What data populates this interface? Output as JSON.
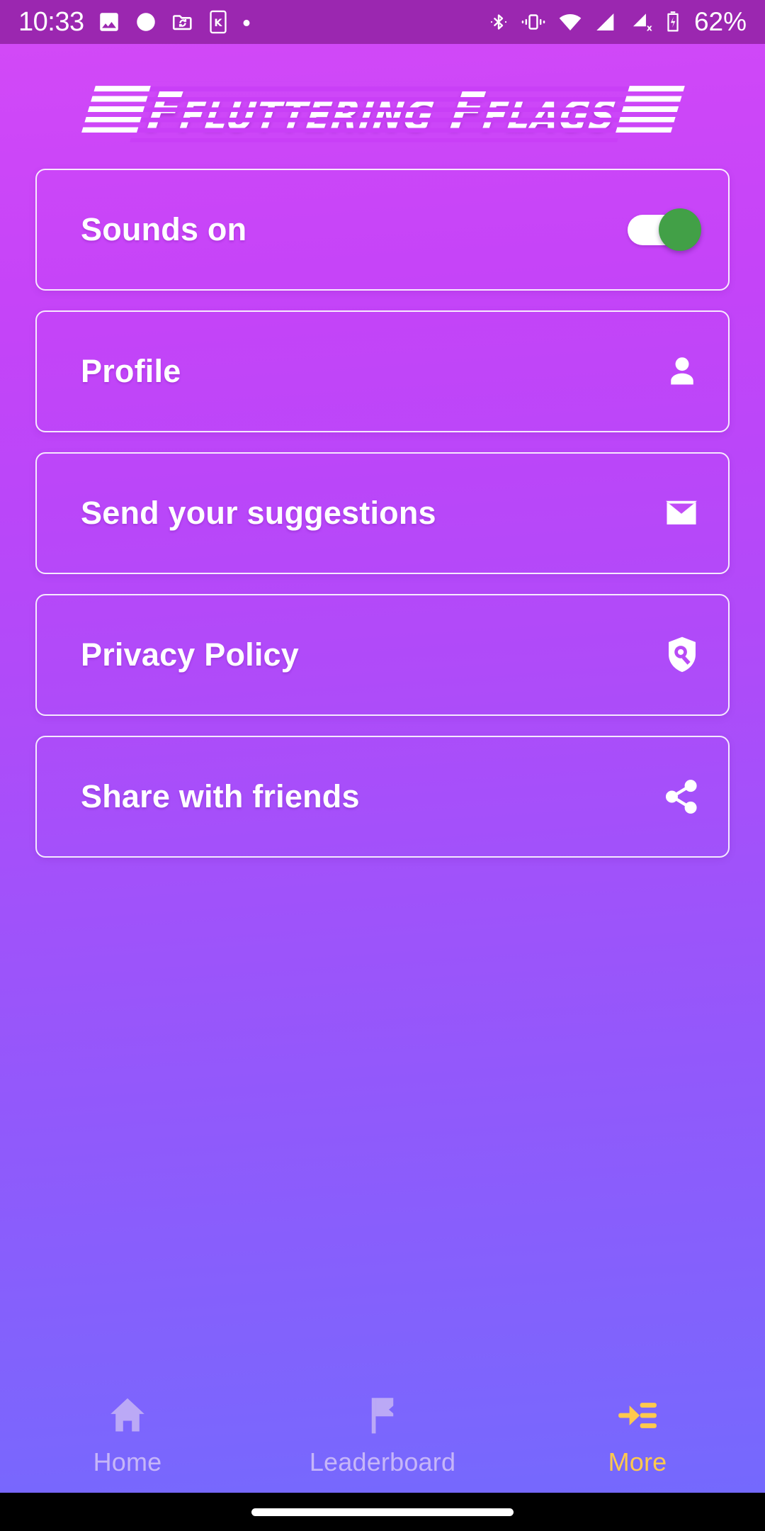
{
  "status_bar": {
    "time": "10:33",
    "battery_percent": "62%",
    "left_icons": [
      "image-icon",
      "record-circle-icon",
      "folder-sync-icon",
      "kindle-badge-icon",
      "dot-icon"
    ],
    "right_icons": [
      "bluetooth-icon",
      "vibrate-icon",
      "wifi-icon",
      "cellular-signal-icon",
      "cellular-no-sim-icon",
      "battery-charging-icon"
    ],
    "background_color": "#9B27B0",
    "foreground_color": "#FFFFFF"
  },
  "header": {
    "logo_part1": "Fluttering",
    "logo_part2": "Flags",
    "logo_text": "Fluttering Flags"
  },
  "theme": {
    "gradient_top": "#D249F7",
    "gradient_bottom": "#7469FD",
    "card_border": "#FFFFFF",
    "toggle_on_color": "#42A047",
    "toggle_track_color": "#FFFFFF",
    "nav_active_color": "#FFC94D",
    "nav_inactive_color": "#C6B6F8"
  },
  "cards": [
    {
      "label": "Sounds on",
      "trailing": "toggle-switch",
      "toggle_on": true,
      "icon": ""
    },
    {
      "label": "Profile",
      "trailing": "icon",
      "icon": "person-icon"
    },
    {
      "label": "Send your suggestions",
      "trailing": "icon",
      "icon": "email-icon"
    },
    {
      "label": "Privacy Policy",
      "trailing": "icon",
      "icon": "privacy-shield-icon"
    },
    {
      "label": "Share with friends",
      "trailing": "icon",
      "icon": "share-icon"
    }
  ],
  "bottom_nav": {
    "items": [
      {
        "label": "Home",
        "icon": "home-icon",
        "active": false
      },
      {
        "label": "Leaderboard",
        "icon": "flag-icon",
        "active": false
      },
      {
        "label": "More",
        "icon": "read-more-icon",
        "active": true
      }
    ]
  }
}
